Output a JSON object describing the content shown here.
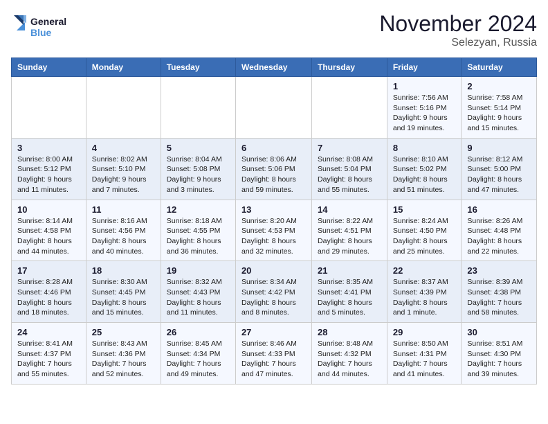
{
  "logo": {
    "line1": "General",
    "line2": "Blue"
  },
  "title": "November 2024",
  "location": "Selezyan, Russia",
  "days_of_week": [
    "Sunday",
    "Monday",
    "Tuesday",
    "Wednesday",
    "Thursday",
    "Friday",
    "Saturday"
  ],
  "weeks": [
    [
      {
        "day": "",
        "info": ""
      },
      {
        "day": "",
        "info": ""
      },
      {
        "day": "",
        "info": ""
      },
      {
        "day": "",
        "info": ""
      },
      {
        "day": "",
        "info": ""
      },
      {
        "day": "1",
        "info": "Sunrise: 7:56 AM\nSunset: 5:16 PM\nDaylight: 9 hours and 19 minutes."
      },
      {
        "day": "2",
        "info": "Sunrise: 7:58 AM\nSunset: 5:14 PM\nDaylight: 9 hours and 15 minutes."
      }
    ],
    [
      {
        "day": "3",
        "info": "Sunrise: 8:00 AM\nSunset: 5:12 PM\nDaylight: 9 hours and 11 minutes."
      },
      {
        "day": "4",
        "info": "Sunrise: 8:02 AM\nSunset: 5:10 PM\nDaylight: 9 hours and 7 minutes."
      },
      {
        "day": "5",
        "info": "Sunrise: 8:04 AM\nSunset: 5:08 PM\nDaylight: 9 hours and 3 minutes."
      },
      {
        "day": "6",
        "info": "Sunrise: 8:06 AM\nSunset: 5:06 PM\nDaylight: 8 hours and 59 minutes."
      },
      {
        "day": "7",
        "info": "Sunrise: 8:08 AM\nSunset: 5:04 PM\nDaylight: 8 hours and 55 minutes."
      },
      {
        "day": "8",
        "info": "Sunrise: 8:10 AM\nSunset: 5:02 PM\nDaylight: 8 hours and 51 minutes."
      },
      {
        "day": "9",
        "info": "Sunrise: 8:12 AM\nSunset: 5:00 PM\nDaylight: 8 hours and 47 minutes."
      }
    ],
    [
      {
        "day": "10",
        "info": "Sunrise: 8:14 AM\nSunset: 4:58 PM\nDaylight: 8 hours and 44 minutes."
      },
      {
        "day": "11",
        "info": "Sunrise: 8:16 AM\nSunset: 4:56 PM\nDaylight: 8 hours and 40 minutes."
      },
      {
        "day": "12",
        "info": "Sunrise: 8:18 AM\nSunset: 4:55 PM\nDaylight: 8 hours and 36 minutes."
      },
      {
        "day": "13",
        "info": "Sunrise: 8:20 AM\nSunset: 4:53 PM\nDaylight: 8 hours and 32 minutes."
      },
      {
        "day": "14",
        "info": "Sunrise: 8:22 AM\nSunset: 4:51 PM\nDaylight: 8 hours and 29 minutes."
      },
      {
        "day": "15",
        "info": "Sunrise: 8:24 AM\nSunset: 4:50 PM\nDaylight: 8 hours and 25 minutes."
      },
      {
        "day": "16",
        "info": "Sunrise: 8:26 AM\nSunset: 4:48 PM\nDaylight: 8 hours and 22 minutes."
      }
    ],
    [
      {
        "day": "17",
        "info": "Sunrise: 8:28 AM\nSunset: 4:46 PM\nDaylight: 8 hours and 18 minutes."
      },
      {
        "day": "18",
        "info": "Sunrise: 8:30 AM\nSunset: 4:45 PM\nDaylight: 8 hours and 15 minutes."
      },
      {
        "day": "19",
        "info": "Sunrise: 8:32 AM\nSunset: 4:43 PM\nDaylight: 8 hours and 11 minutes."
      },
      {
        "day": "20",
        "info": "Sunrise: 8:34 AM\nSunset: 4:42 PM\nDaylight: 8 hours and 8 minutes."
      },
      {
        "day": "21",
        "info": "Sunrise: 8:35 AM\nSunset: 4:41 PM\nDaylight: 8 hours and 5 minutes."
      },
      {
        "day": "22",
        "info": "Sunrise: 8:37 AM\nSunset: 4:39 PM\nDaylight: 8 hours and 1 minute."
      },
      {
        "day": "23",
        "info": "Sunrise: 8:39 AM\nSunset: 4:38 PM\nDaylight: 7 hours and 58 minutes."
      }
    ],
    [
      {
        "day": "24",
        "info": "Sunrise: 8:41 AM\nSunset: 4:37 PM\nDaylight: 7 hours and 55 minutes."
      },
      {
        "day": "25",
        "info": "Sunrise: 8:43 AM\nSunset: 4:36 PM\nDaylight: 7 hours and 52 minutes."
      },
      {
        "day": "26",
        "info": "Sunrise: 8:45 AM\nSunset: 4:34 PM\nDaylight: 7 hours and 49 minutes."
      },
      {
        "day": "27",
        "info": "Sunrise: 8:46 AM\nSunset: 4:33 PM\nDaylight: 7 hours and 47 minutes."
      },
      {
        "day": "28",
        "info": "Sunrise: 8:48 AM\nSunset: 4:32 PM\nDaylight: 7 hours and 44 minutes."
      },
      {
        "day": "29",
        "info": "Sunrise: 8:50 AM\nSunset: 4:31 PM\nDaylight: 7 hours and 41 minutes."
      },
      {
        "day": "30",
        "info": "Sunrise: 8:51 AM\nSunset: 4:30 PM\nDaylight: 7 hours and 39 minutes."
      }
    ]
  ]
}
